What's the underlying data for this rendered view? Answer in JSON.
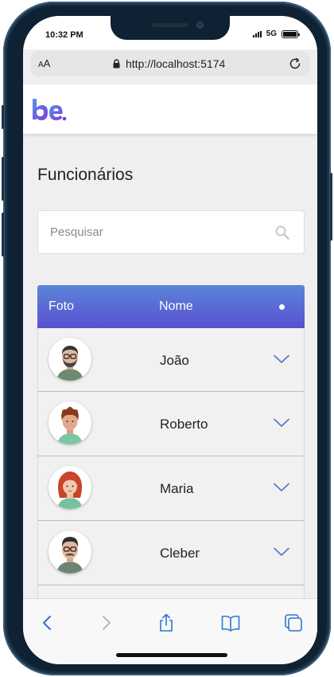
{
  "status": {
    "time": "10:32 PM",
    "network": "5G"
  },
  "browser": {
    "text_size_label": "AA",
    "url": "http://localhost:5174"
  },
  "page": {
    "title": "Funcionários",
    "search": {
      "placeholder": "Pesquisar",
      "value": ""
    },
    "table": {
      "headers": {
        "photo": "Foto",
        "name": "Nome"
      },
      "rows": [
        {
          "name": "João",
          "avatar": "man-glasses-beard-avatar"
        },
        {
          "name": "Roberto",
          "avatar": "man-curly-hair-avatar"
        },
        {
          "name": "Maria",
          "avatar": "woman-red-hair-avatar"
        },
        {
          "name": "Cleber",
          "avatar": "man-glasses-mustache-avatar"
        }
      ]
    }
  },
  "colors": {
    "header_gradient_start": "#5a86d8",
    "header_gradient_end": "#5a4fd1",
    "logo_start": "#5b8def",
    "logo_end": "#7b3fd6",
    "safari_blue": "#2f74d0"
  },
  "toolbar": {
    "items": [
      "back-icon",
      "forward-icon",
      "share-icon",
      "bookmarks-icon",
      "tabs-icon"
    ]
  }
}
